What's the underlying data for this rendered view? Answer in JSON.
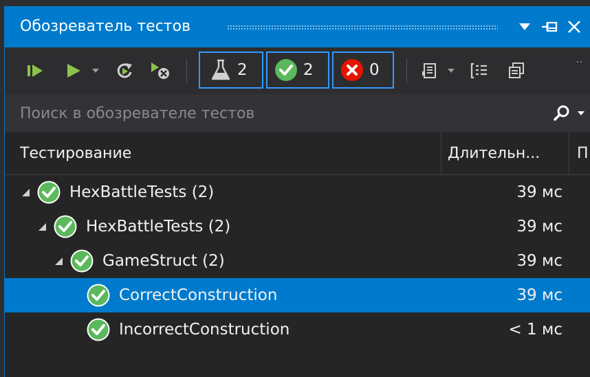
{
  "window": {
    "title": "Обозреватель тестов"
  },
  "toolbar": {
    "run_all": "run-all-icon",
    "run": "run-icon",
    "rerun": "rerun-icon",
    "cancel": "cancel-run-icon",
    "filters": [
      {
        "icon": "flask-icon",
        "count": "2"
      },
      {
        "icon": "passed-icon",
        "count": "2"
      },
      {
        "icon": "failed-icon",
        "count": "0"
      }
    ]
  },
  "search": {
    "placeholder": "Поиск в обозревателе тестов"
  },
  "columns": {
    "test": "Тестирование",
    "duration": "Длительн...",
    "third": "П"
  },
  "rows": [
    {
      "name": "HexBattleTests (2)",
      "duration": "39 мс",
      "level": 0,
      "expanded": true,
      "status": "passed",
      "selected": false
    },
    {
      "name": "HexBattleTests (2)",
      "duration": "39 мс",
      "level": 1,
      "expanded": true,
      "status": "passed",
      "selected": false
    },
    {
      "name": "GameStruct (2)",
      "duration": "39 мс",
      "level": 2,
      "expanded": true,
      "status": "passed",
      "selected": false
    },
    {
      "name": "CorrectConstruction",
      "duration": "39 мс",
      "level": 3,
      "expanded": false,
      "status": "passed",
      "selected": true
    },
    {
      "name": "IncorrectConstruction",
      "duration": "< 1 мс",
      "level": 3,
      "expanded": false,
      "status": "passed",
      "selected": false
    }
  ],
  "colors": {
    "accent": "#007acc",
    "passed": "#5cb85c",
    "failed": "#e51400",
    "background": "#252526"
  }
}
